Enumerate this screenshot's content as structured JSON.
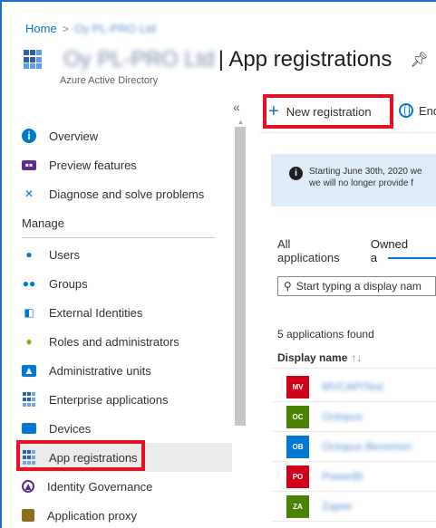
{
  "breadcrumb": {
    "home": "Home",
    "separator": ">",
    "tenant": "Oy PL-PRO Ltd"
  },
  "header": {
    "tenant": "Oy PL-PRO Ltd",
    "title": "| App registrations",
    "subtitle": "Azure Active Directory",
    "pin_icon": "pin-icon"
  },
  "sidebar": {
    "collapse": "«",
    "section_manage": "Manage",
    "items_top": [
      {
        "label": "Overview",
        "icon": "info-icon"
      },
      {
        "label": "Preview features",
        "icon": "preview-icon"
      },
      {
        "label": "Diagnose and solve problems",
        "icon": "wrench-icon"
      }
    ],
    "items_manage": [
      {
        "label": "Users",
        "icon": "user-icon"
      },
      {
        "label": "Groups",
        "icon": "group-icon"
      },
      {
        "label": "External Identities",
        "icon": "external-identities-icon"
      },
      {
        "label": "Roles and administrators",
        "icon": "roles-icon"
      },
      {
        "label": "Administrative units",
        "icon": "admin-units-icon"
      },
      {
        "label": "Enterprise applications",
        "icon": "grid-icon"
      },
      {
        "label": "Devices",
        "icon": "device-icon"
      },
      {
        "label": "App registrations",
        "icon": "grid-icon",
        "active": true
      },
      {
        "label": "Identity Governance",
        "icon": "governance-icon"
      },
      {
        "label": "Application proxy",
        "icon": "proxy-icon"
      }
    ]
  },
  "toolbar": {
    "new_registration": "New registration",
    "endpoints": "End",
    "plus_icon": "plus-icon",
    "globe_icon": "globe-icon"
  },
  "info": {
    "line1": "Starting June 30th, 2020 we",
    "line2": "we will no longer provide f"
  },
  "tabs": {
    "all": "All applications",
    "owned": "Owned a"
  },
  "search": {
    "placeholder": "Start typing a display nam"
  },
  "list": {
    "count": "5 applications found",
    "column": "Display name",
    "sort": "↑↓",
    "apps": [
      {
        "initials": "MV",
        "name": "MVCAPITest",
        "color": "#d0021b"
      },
      {
        "initials": "OC",
        "name": "Octopus",
        "color": "#498205"
      },
      {
        "initials": "OB",
        "name": "Octopus Benemen",
        "color": "#0078d4"
      },
      {
        "initials": "PO",
        "name": "PowerBI",
        "color": "#d0021b"
      },
      {
        "initials": "ZA",
        "name": "Zapier",
        "color": "#498205"
      }
    ]
  }
}
